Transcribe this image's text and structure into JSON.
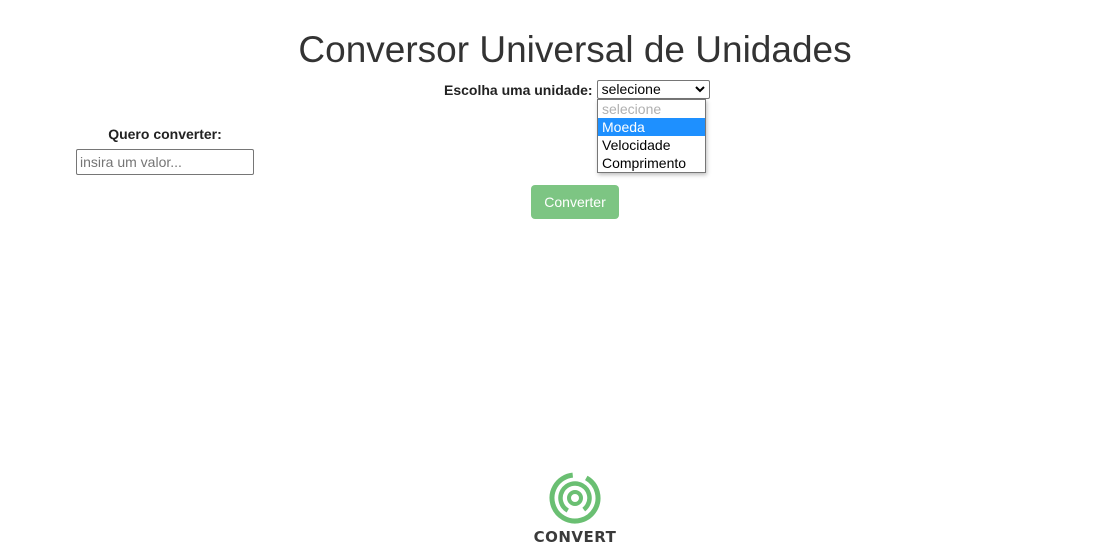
{
  "header": {
    "title": "Conversor Universal de Unidades"
  },
  "unit_select": {
    "label": "Escolha uma unidade:",
    "selected_value": "selecione",
    "options": [
      {
        "label": "selecione",
        "state": "disabled"
      },
      {
        "label": "Moeda",
        "state": "highlighted"
      },
      {
        "label": "Velocidade",
        "state": "normal"
      },
      {
        "label": "Comprimento",
        "state": "normal"
      }
    ]
  },
  "convert_input": {
    "label": "Quero converter:",
    "value": "",
    "placeholder": "insira um valor..."
  },
  "actions": {
    "convert_label": "Converter"
  },
  "footer": {
    "logo_text": "CONVERT"
  },
  "colors": {
    "button_bg": "#7dc583",
    "highlight": "#1e90ff",
    "logo_green": "#6abf72"
  },
  "icons": {
    "select_chevron": "chevron-down-icon",
    "logo": "concentric-circles-logo-icon"
  }
}
